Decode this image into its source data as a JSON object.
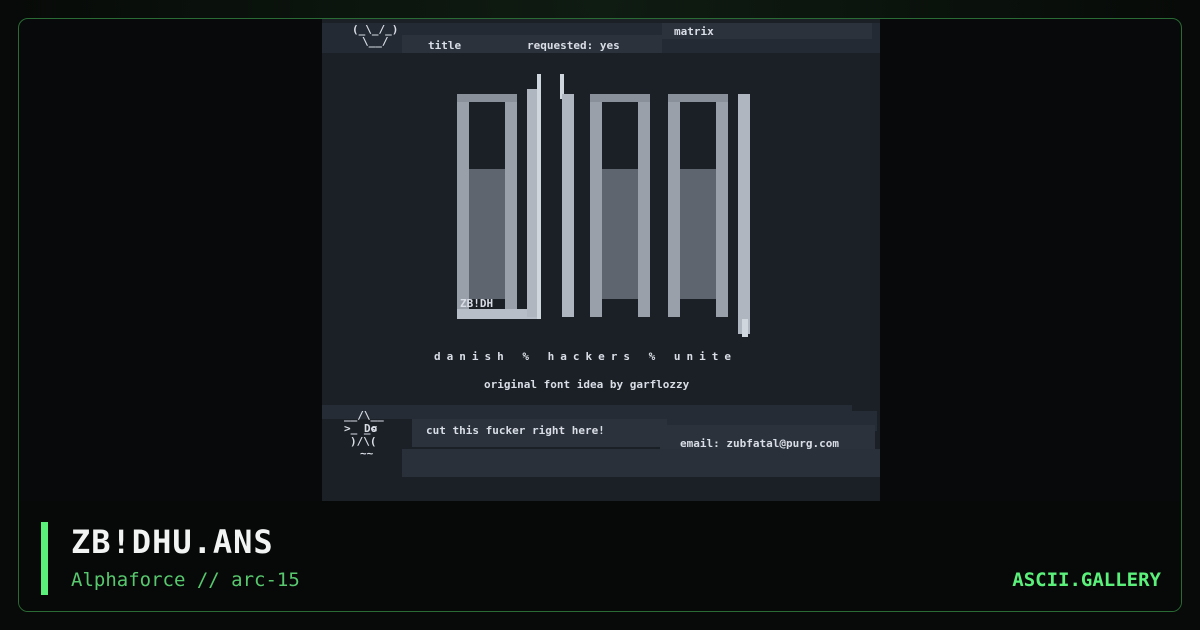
{
  "art": {
    "header_left": "title",
    "header_mid": "requested: yes",
    "header_right": "matrix",
    "tagline": "danish % hackers % unite",
    "credit": "original font idea by garflozzy",
    "cut_text": "cut this fucker right here!",
    "email_text": "email: zubfatal@purg.com",
    "logo_text": "Do",
    "signature": "ZB!DH"
  },
  "footer": {
    "title": "ZB!DHU.ANS",
    "subtitle": "Alphaforce // arc-15",
    "brand": "ASCII.GALLERY"
  },
  "colors": {
    "accent": "#5af07a",
    "art_bg": "#1b1f26",
    "art_text": "#d9dee6"
  }
}
